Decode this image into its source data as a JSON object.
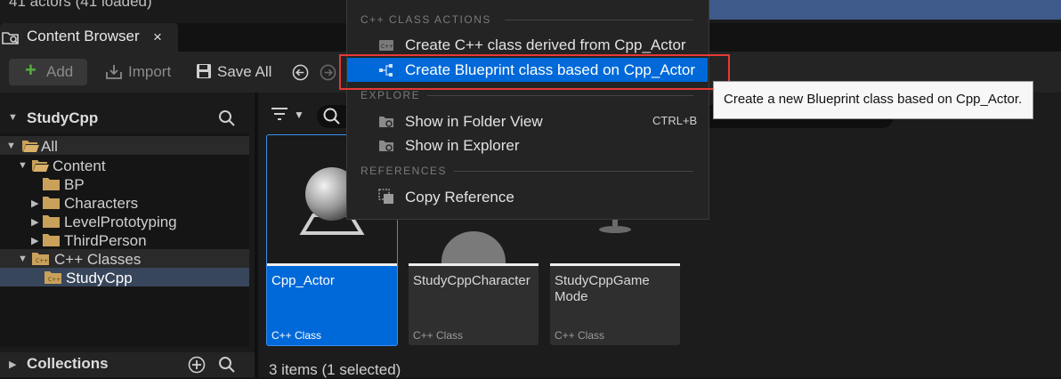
{
  "top": {
    "actor_count": "41 actors (41 loaded)"
  },
  "tab": {
    "title": "Content Browser",
    "close_glyph": "×",
    "icon": "content-browser-icon"
  },
  "toolbar": {
    "add_label": "Add",
    "import_label": "Import",
    "save_all_label": "Save All",
    "back_icon": "back-arrow-icon",
    "forward_icon": "forward-arrow-icon"
  },
  "sources": {
    "project": "StudyCpp",
    "tree": [
      {
        "label": "All",
        "expanded": true
      },
      {
        "label": "Content",
        "expanded": true
      },
      {
        "label": "BP"
      },
      {
        "label": "Characters"
      },
      {
        "label": "LevelPrototyping"
      },
      {
        "label": "ThirdPerson"
      },
      {
        "label": "C++ Classes",
        "expanded": true
      },
      {
        "label": "StudyCpp",
        "selected": true
      }
    ],
    "collections_label": "Collections"
  },
  "assets": {
    "tiles": [
      {
        "name": "Cpp_Actor",
        "type": "C++ Class",
        "selected": true
      },
      {
        "name": "StudyCppCharacter",
        "type": "C++ Class"
      },
      {
        "name": "StudyCppGame Mode",
        "type": "C++ Class"
      }
    ],
    "status": "3 items (1 selected)"
  },
  "context_menu": {
    "section_cpp": "C++ CLASS ACTIONS",
    "create_cpp": "Create C++ class derived from Cpp_Actor",
    "create_bp": "Create Blueprint class based on Cpp_Actor",
    "section_explore": "EXPLORE",
    "show_folder": "Show in Folder View",
    "show_folder_shortcut": "CTRL+B",
    "show_explorer": "Show in Explorer",
    "section_references": "REFERENCES",
    "copy_reference": "Copy Reference"
  },
  "tooltip": {
    "text": "Create a new Blueprint class based on Cpp_Actor."
  },
  "colors": {
    "accent": "#0069d9",
    "highlight": "#e53935",
    "folder": "#c9a15a"
  }
}
